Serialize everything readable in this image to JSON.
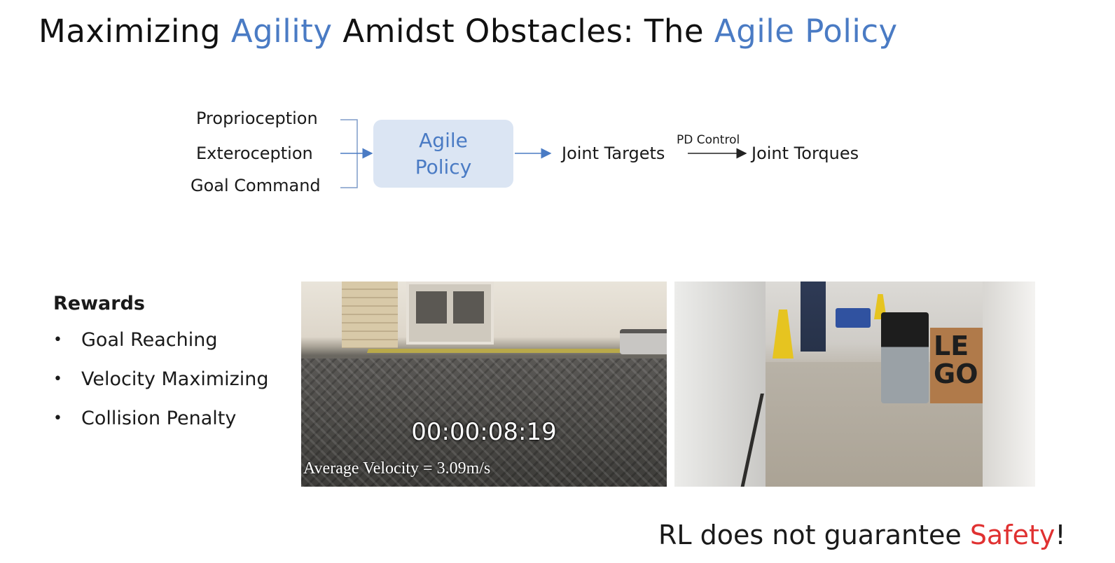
{
  "title": {
    "part1": "Maximizing ",
    "accent1": "Agility",
    "part2": " Amidst Obstacles: The ",
    "accent2": "Agile Policy"
  },
  "diagram": {
    "inputs": [
      "Proprioception",
      "Exteroception",
      "Goal Command"
    ],
    "policy_label": "Agile Policy",
    "output": "Joint Targets",
    "edge_label": "PD Control",
    "final": "Joint Torques"
  },
  "rewards": {
    "title": "Rewards",
    "items": [
      "Goal Reaching",
      "Velocity Maximizing",
      "Collision Penalty"
    ]
  },
  "video_left": {
    "timecode": "00:00:08:19",
    "caption": "Average Velocity = 3.09m/s"
  },
  "video_right": {
    "box_text": "LEGO"
  },
  "footer": {
    "part1": "RL does not guarantee ",
    "accent": "Safety",
    "part2": "!"
  },
  "colors": {
    "accent": "#4a7bc4",
    "danger": "#e03131",
    "policy_box": "#dbe5f3"
  }
}
